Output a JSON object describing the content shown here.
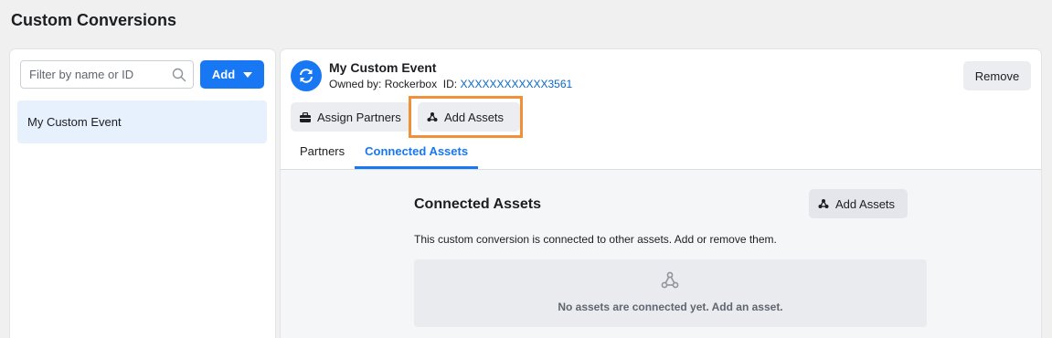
{
  "page": {
    "title": "Custom Conversions"
  },
  "sidebar": {
    "search": {
      "placeholder": "Filter by name or ID",
      "value": ""
    },
    "add_label": "Add",
    "items": [
      {
        "label": "My Custom Event"
      }
    ]
  },
  "detail": {
    "title": "My Custom Event",
    "owned_by_label": "Owned by:",
    "owner": "Rockerbox",
    "id_label": "ID:",
    "id_value": "XXXXXXXXXXXX3561",
    "remove_label": "Remove",
    "assign_partners_label": "Assign Partners",
    "add_assets_label": "Add Assets",
    "tabs": [
      {
        "label": "Partners",
        "active": false
      },
      {
        "label": "Connected Assets",
        "active": true
      }
    ],
    "connected_assets": {
      "title": "Connected Assets",
      "add_assets_label": "Add Assets",
      "description": "This custom conversion is connected to other assets. Add or remove them.",
      "empty_message": "No assets are connected yet. Add an asset."
    }
  },
  "colors": {
    "accent": "#1877f2",
    "highlight": "#f0913a",
    "link": "#0a66c2"
  },
  "icons": {
    "search": "search-icon",
    "event": "sync-icon",
    "assign": "briefcase-icon",
    "assets": "assets-icon",
    "dropdown": "caret-down-icon"
  }
}
